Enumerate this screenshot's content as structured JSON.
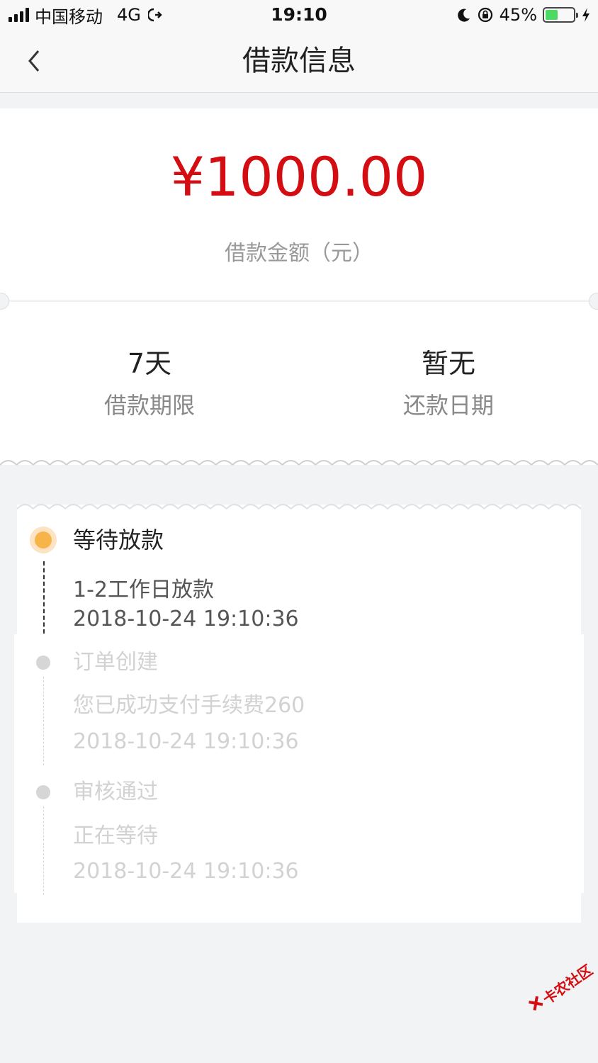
{
  "status_bar": {
    "carrier": "中国移动",
    "network": "4G",
    "time": "19:10",
    "battery_percent": "45%",
    "battery_level": 0.45
  },
  "nav": {
    "title": "借款信息",
    "back_icon": "chevron-left-icon"
  },
  "loan": {
    "amount": "¥1000.00",
    "amount_label": "借款金额（元）",
    "term_value": "7天",
    "term_label": "借款期限",
    "repay_value": "暂无",
    "repay_label": "还款日期"
  },
  "timeline": [
    {
      "title": "等待放款",
      "lines": [
        "1-2工作日放款",
        "2018-10-24 19:10:36"
      ],
      "active": true
    },
    {
      "title": "订单创建",
      "lines": [
        "您已成功支付手续费260",
        "2018-10-24 19:10:36"
      ],
      "active": false
    },
    {
      "title": "审核通过",
      "lines": [
        "正在等待",
        "2018-10-24 19:10:36"
      ],
      "active": false
    }
  ],
  "watermark": {
    "text": "卡农社区"
  },
  "colors": {
    "accent_red": "#d40d12",
    "active_dot": "#f7b549",
    "battery_green": "#4cd964",
    "background": "#f2f3f5"
  }
}
